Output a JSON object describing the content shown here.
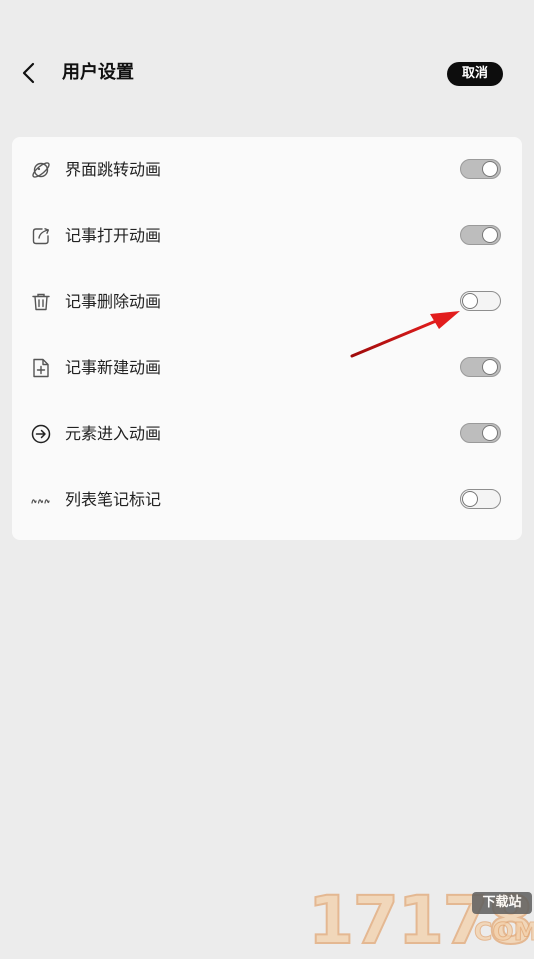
{
  "header": {
    "title": "用户设置",
    "cancel_label": "取消",
    "back_icon": "chevron-left-icon"
  },
  "settings": [
    {
      "label": "界面跳转动画",
      "icon": "planet-icon",
      "enabled": true
    },
    {
      "label": "记事打开动画",
      "icon": "edit-note-icon",
      "enabled": true
    },
    {
      "label": "记事删除动画",
      "icon": "trash-icon",
      "enabled": false
    },
    {
      "label": "记事新建动画",
      "icon": "new-file-icon",
      "enabled": true
    },
    {
      "label": "元素进入动画",
      "icon": "arrow-circle-right-icon",
      "enabled": true
    },
    {
      "label": "列表笔记标记",
      "icon": "wave-mark-icon",
      "enabled": false
    }
  ],
  "colors": {
    "background": "#ececec",
    "card": "#fafafa",
    "toggle_on": "#bdbdbd",
    "toggle_off": "#f4f4f4",
    "annotation_arrow": "#d11919"
  },
  "watermark": {
    "digits": "17178",
    "tag": "下载站",
    "domain": "COM"
  }
}
